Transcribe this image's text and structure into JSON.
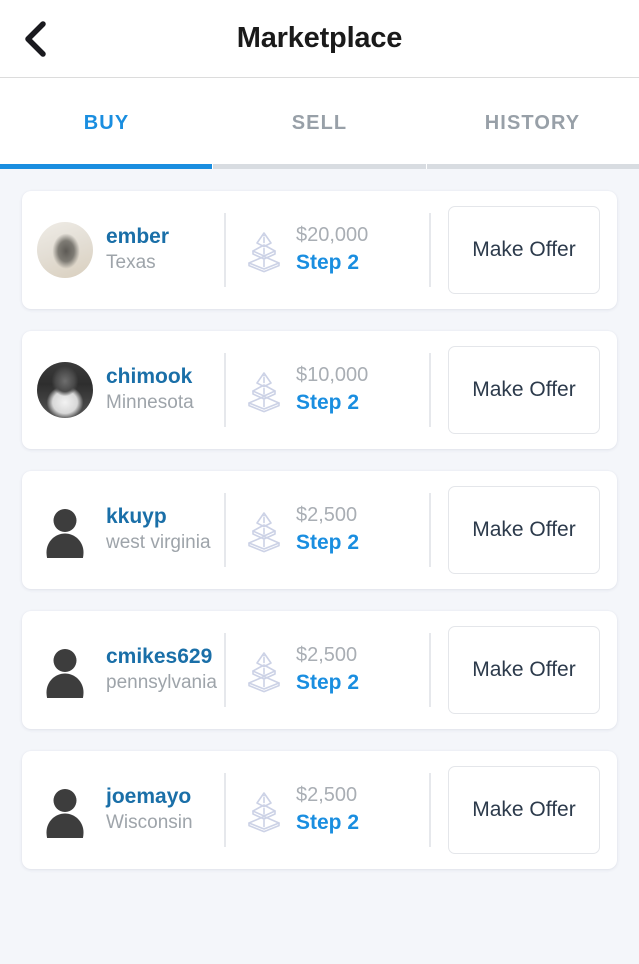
{
  "header": {
    "title": "Marketplace",
    "back_icon": "chevron-left-icon"
  },
  "tabs": [
    {
      "label": "BUY",
      "active": true
    },
    {
      "label": "SELL",
      "active": false
    },
    {
      "label": "HISTORY",
      "active": false
    }
  ],
  "theme": {
    "accent_blue": "#1a8ee0",
    "username_blue": "#1a6fa8",
    "muted_gray": "#9ea4aa",
    "page_background": "#f4f6fa",
    "card_background": "#ffffff",
    "button_text": "#2c3a4b",
    "divider": "#e6e8ec"
  },
  "list": {
    "action_label": "Make Offer",
    "step_icon": "pyramid-tiers-icon",
    "items": [
      {
        "username": "ember",
        "location": "Texas",
        "price": "$20,000",
        "step": "Step 2",
        "avatar_type": "photo-a"
      },
      {
        "username": "chimook",
        "location": "Minnesota",
        "price": "$10,000",
        "step": "Step 2",
        "avatar_type": "photo-b"
      },
      {
        "username": "kkuyp",
        "location": "west virginia",
        "price": "$2,500",
        "step": "Step 2",
        "avatar_type": "placeholder"
      },
      {
        "username": "cmikes629",
        "location": "pennsylvania",
        "price": "$2,500",
        "step": "Step 2",
        "avatar_type": "placeholder"
      },
      {
        "username": "joemayo",
        "location": "Wisconsin",
        "price": "$2,500",
        "step": "Step 2",
        "avatar_type": "placeholder"
      }
    ]
  }
}
